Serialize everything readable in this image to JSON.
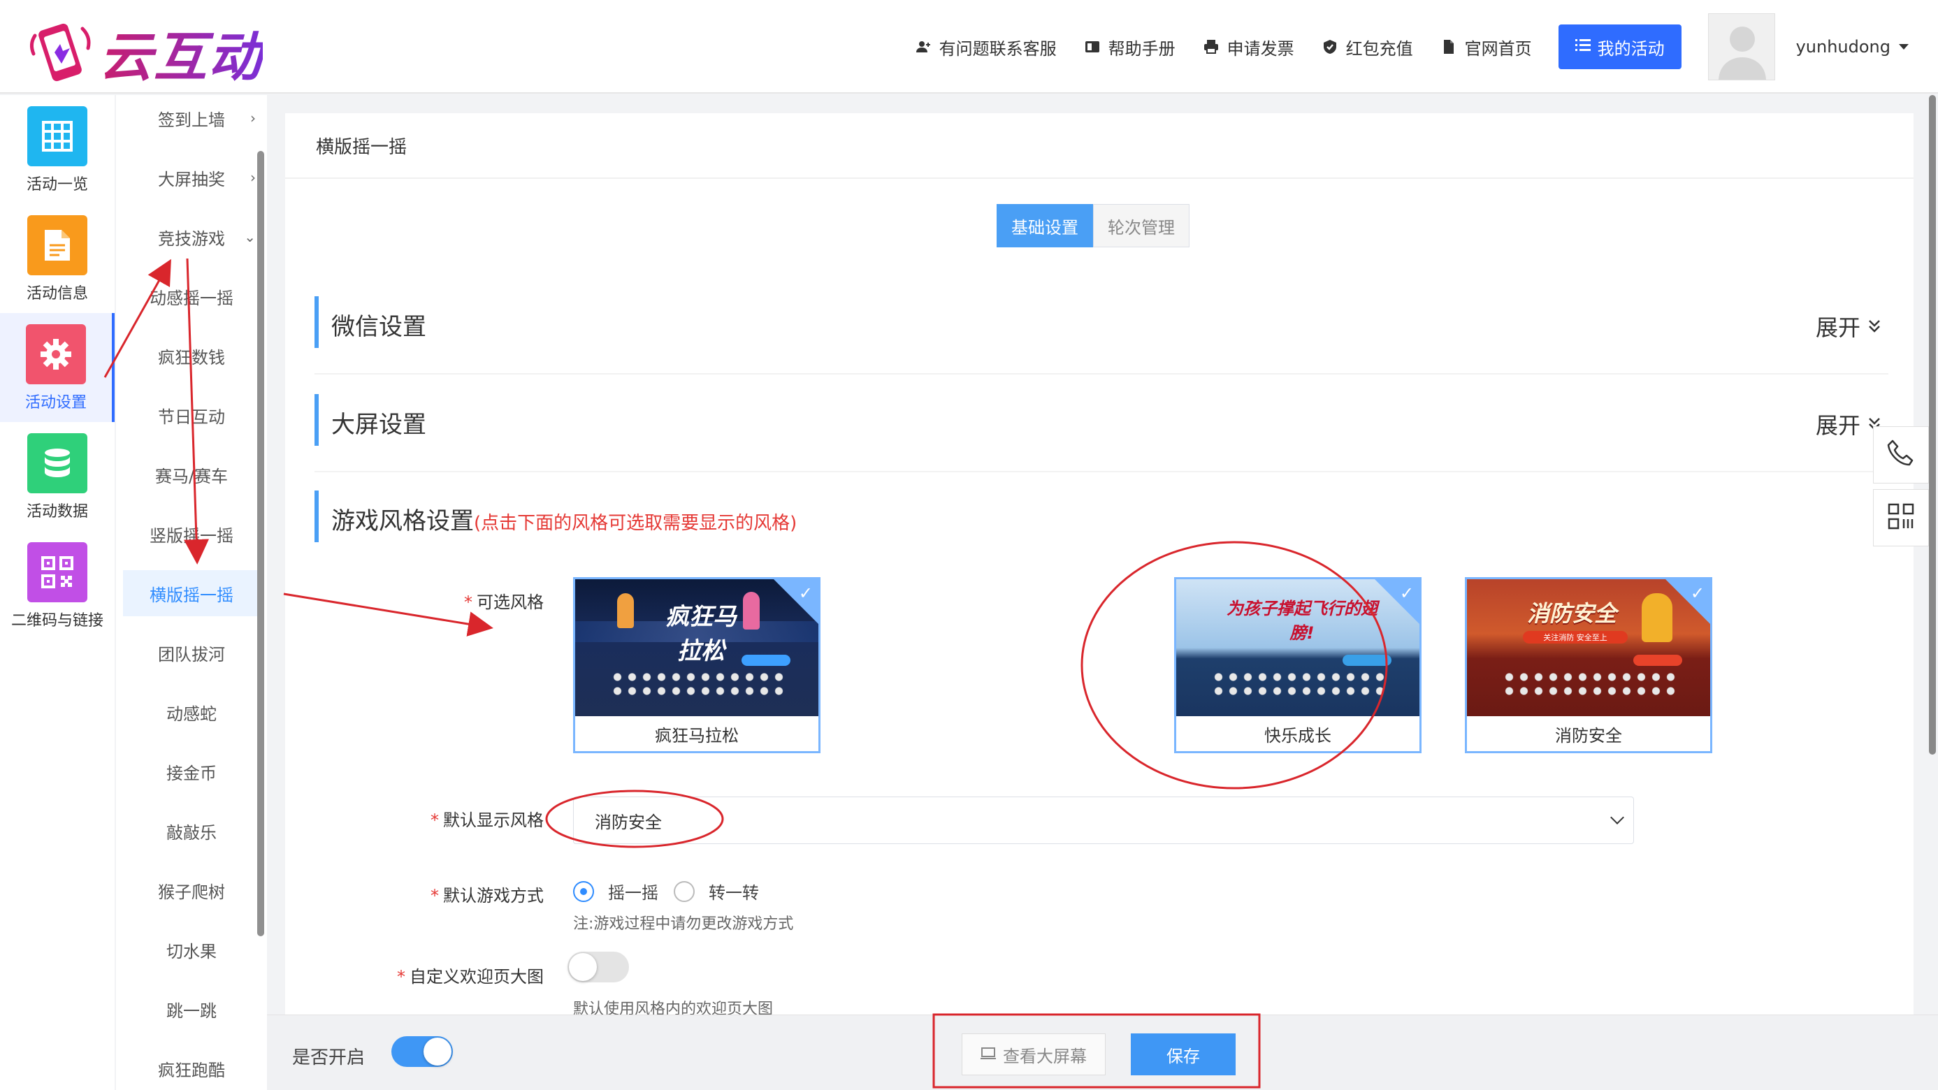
{
  "brand": {
    "name": "云互动"
  },
  "header": {
    "links": [
      {
        "icon": "user-plus-icon",
        "label": "有问题联系客服"
      },
      {
        "icon": "book-icon",
        "label": "帮助手册"
      },
      {
        "icon": "printer-icon",
        "label": "申请发票"
      },
      {
        "icon": "shield-check-icon",
        "label": "红包充值"
      },
      {
        "icon": "file-icon",
        "label": "官网首页"
      }
    ],
    "my_activity": "我的活动",
    "username": "yunhudong"
  },
  "rail": {
    "items": [
      {
        "label": "活动一览",
        "icon": "grid-icon",
        "color": "#1fb6f0"
      },
      {
        "label": "活动信息",
        "icon": "document-icon",
        "color": "#f99a1c"
      },
      {
        "label": "活动设置",
        "icon": "gear-icon",
        "color": "#f1546d",
        "active": true
      },
      {
        "label": "活动数据",
        "icon": "database-icon",
        "color": "#2fd07a"
      },
      {
        "label": "二维码与链接",
        "icon": "qrcode-icon",
        "color": "#c14fe6"
      }
    ]
  },
  "submenu": {
    "items": [
      {
        "label": "签到上墙",
        "chevron": "›"
      },
      {
        "label": "大屏抽奖",
        "chevron": "›"
      },
      {
        "label": "竞技游戏",
        "chevron": "⌄"
      },
      {
        "label": "动感摇一摇"
      },
      {
        "label": "疯狂数钱"
      },
      {
        "label": "节日互动"
      },
      {
        "label": "赛马/赛车"
      },
      {
        "label": "竖版摇一摇"
      },
      {
        "label": "横版摇一摇",
        "active": true
      },
      {
        "label": "团队拔河"
      },
      {
        "label": "动感蛇"
      },
      {
        "label": "接金币"
      },
      {
        "label": "敲敲乐"
      },
      {
        "label": "猴子爬树"
      },
      {
        "label": "切水果"
      },
      {
        "label": "跳一跳"
      },
      {
        "label": "疯狂跑酷"
      }
    ]
  },
  "main": {
    "breadcrumb": "横版摇一摇",
    "tabs": [
      {
        "label": "基础设置",
        "active": true
      },
      {
        "label": "轮次管理"
      }
    ],
    "sections": {
      "wechat": {
        "title": "微信设置",
        "expand": "展开"
      },
      "screen": {
        "title": "大屏设置",
        "expand": "展开"
      },
      "style": {
        "title": "游戏风格设置",
        "hint": "(点击下面的风格可选取需要显示的风格)"
      }
    },
    "fields": {
      "styles_label": "可选风格",
      "styles": [
        {
          "name": "疯狂马拉松",
          "banner": "疯狂马拉松",
          "selected": true
        },
        {
          "name": "快乐成长",
          "banner": "为孩子撑起飞行的翅膀!",
          "selected": true
        },
        {
          "name": "消防安全",
          "banner": "消防安全",
          "tagline": "关注消防 安全至上",
          "selected": true
        }
      ],
      "default_style_label": "默认显示风格",
      "default_style_value": "消防安全",
      "game_mode_label": "默认游戏方式",
      "game_mode_options": [
        {
          "label": "摇一摇",
          "checked": true
        },
        {
          "label": "转一转",
          "checked": false
        }
      ],
      "game_mode_note": "注:游戏过程中请勿更改游戏方式",
      "welcome_image_label": "自定义欢迎页大图",
      "welcome_image_on": false,
      "welcome_image_note": "默认使用风格内的欢迎页大图"
    }
  },
  "bottom": {
    "enabled_label": "是否开启",
    "enabled": true,
    "view_screen": "查看大屏幕",
    "save": "保存"
  }
}
